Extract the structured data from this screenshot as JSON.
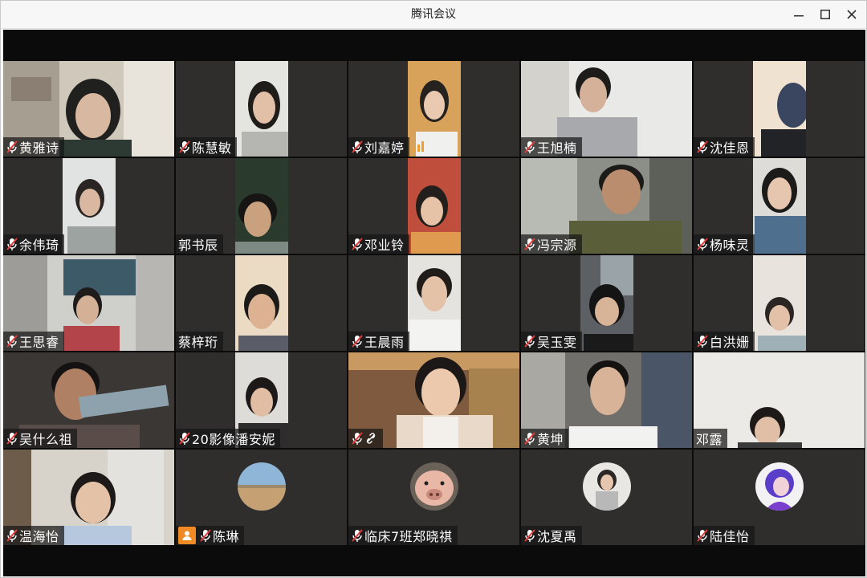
{
  "window": {
    "title": "腾讯会议"
  },
  "controls": {
    "minimize": "minimize-icon",
    "maximize": "maximize-icon",
    "close": "close-icon"
  },
  "participants": [
    {
      "name": "黄雅诗",
      "muted": true
    },
    {
      "name": "陈慧敏",
      "muted": true
    },
    {
      "name": "刘嘉婷",
      "muted": true,
      "signal_icon": "signal-bars-icon"
    },
    {
      "name": "王旭楠",
      "muted": true
    },
    {
      "name": "沈佳恩",
      "muted": true
    },
    {
      "name": "余伟琦",
      "muted": true
    },
    {
      "name": "郭书辰",
      "muted": false
    },
    {
      "name": "邓业铃",
      "muted": true
    },
    {
      "name": "冯宗源",
      "muted": true
    },
    {
      "name": "杨味灵",
      "muted": true
    },
    {
      "name": "王思睿",
      "muted": true
    },
    {
      "name": "蔡梓珩",
      "muted": false
    },
    {
      "name": "王晨雨",
      "muted": true
    },
    {
      "name": "吴玉雯",
      "muted": true
    },
    {
      "name": "白洪姗",
      "muted": true
    },
    {
      "name": "吴什么祖",
      "muted": true
    },
    {
      "name": "20影像潘安妮",
      "muted": true
    },
    {
      "name": "",
      "muted": true,
      "icon": "link-icon"
    },
    {
      "name": "黄坤",
      "muted": true
    },
    {
      "name": "邓露",
      "muted": false
    },
    {
      "name": "温海怡",
      "muted": true
    },
    {
      "name": "陈琳",
      "muted": true,
      "badge": "user-icon"
    },
    {
      "name": "临床7班郑晓祺",
      "muted": true
    },
    {
      "name": "沈夏禹",
      "muted": true
    },
    {
      "name": "陆佳怡",
      "muted": true
    }
  ]
}
